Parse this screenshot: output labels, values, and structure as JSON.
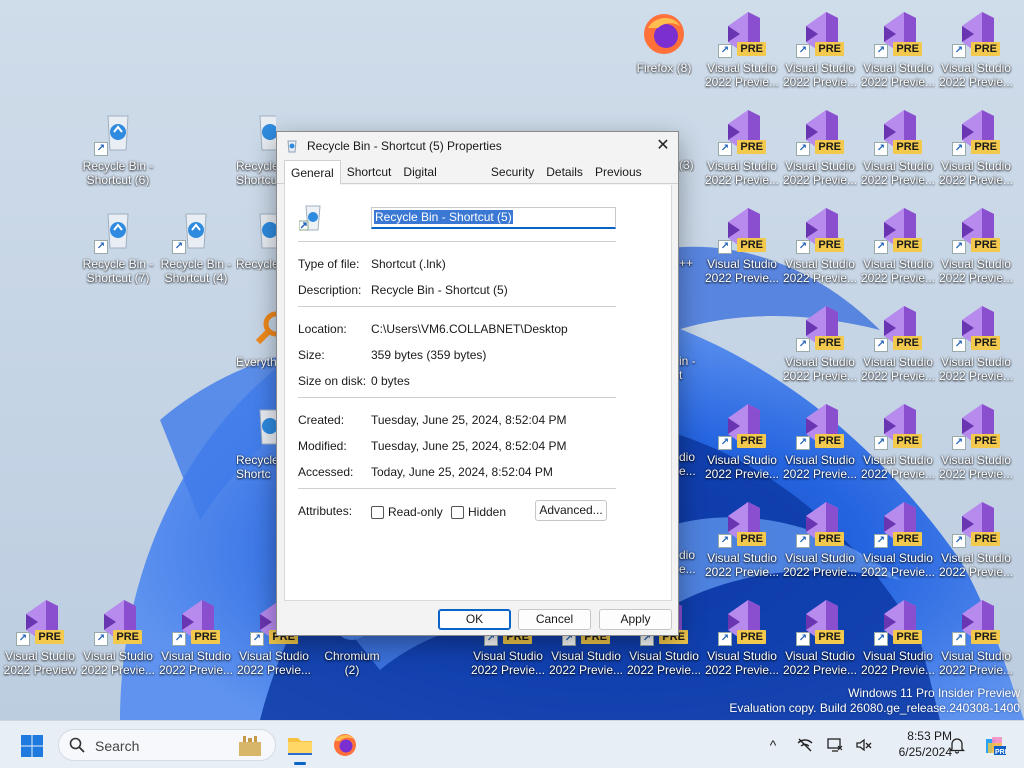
{
  "desktop": {
    "icons": [
      {
        "id": "rb6",
        "label": "Recycle Bin -\nShortcut (6)",
        "type": "recycle"
      },
      {
        "id": "rb7",
        "label": "Recycle Bin -\nShortcut (7)",
        "type": "recycle"
      },
      {
        "id": "rb4",
        "label": "Recycle Bin -\nShortcut (4)",
        "type": "recycle"
      },
      {
        "id": "firefox",
        "label": "Firefox (8)",
        "type": "firefox"
      },
      {
        "id": "chromium",
        "label": "Chromium\n(2)",
        "type": "chromium"
      },
      {
        "id": "vs",
        "label": "Visual Studio\n2022 Previe...",
        "type": "vs"
      },
      {
        "id": "vs-full",
        "label": "Visual Studio\n2022 Preview",
        "type": "vs"
      }
    ],
    "partial_labels": {
      "recycle_a": "Recycle\nShortcu",
      "recycle_b": "Recycle",
      "recycle_c": "Recycle\nShortc",
      "everything": "Everyth",
      "num3": "(3)",
      "plusplus": "++",
      "bin_right": "in -\nt",
      "dio_a": "dio\ne...",
      "dio_b": "dio\ne...",
      "dio_c": "dio\ne..."
    },
    "pre_badge": "PRE"
  },
  "dialog": {
    "title": "Recycle Bin - Shortcut (5) Properties",
    "close_glyph": "✕",
    "tabs": [
      {
        "label": "General",
        "active": true
      },
      {
        "label": "Shortcut",
        "active": false
      },
      {
        "label": "Digital Signatures",
        "active": false
      },
      {
        "label": "Security",
        "active": false
      },
      {
        "label": "Details",
        "active": false
      },
      {
        "label": "Previous Versions",
        "active": false
      }
    ],
    "name_value": "Recycle Bin - Shortcut (5)",
    "fields": {
      "type_label": "Type of file:",
      "type_value": "Shortcut (.lnk)",
      "desc_label": "Description:",
      "desc_value": "Recycle Bin - Shortcut (5)",
      "loc_label": "Location:",
      "loc_value": "C:\\Users\\VM6.COLLABNET\\Desktop",
      "size_label": "Size:",
      "size_value": "359 bytes (359 bytes)",
      "disk_label": "Size on disk:",
      "disk_value": "0 bytes",
      "created_label": "Created:",
      "created_value": "Tuesday, June 25, 2024, 8:52:04 PM",
      "modified_label": "Modified:",
      "modified_value": "Tuesday, June 25, 2024, 8:52:04 PM",
      "accessed_label": "Accessed:",
      "accessed_value": "Today, June 25, 2024, 8:52:04 PM",
      "attr_label": "Attributes:"
    },
    "checkboxes": [
      {
        "label": "Read-only",
        "checked": false
      },
      {
        "label": "Hidden",
        "checked": false
      }
    ],
    "advanced_label": "Advanced...",
    "buttons": {
      "ok": "OK",
      "cancel": "Cancel",
      "apply": "Apply"
    }
  },
  "watermark": {
    "line1": "Windows 11 Pro Insider Preview",
    "line2": "Evaluation copy. Build 26080.ge_release.240308-1400"
  },
  "taskbar": {
    "search_placeholder": "Search",
    "time": "8:53 PM",
    "date": "6/25/2024",
    "tray_expand": "^"
  },
  "colors": {
    "accent": "#0a64c8",
    "vs_purple": "#8a4fcf",
    "pre_yellow": "#f2c94c"
  }
}
